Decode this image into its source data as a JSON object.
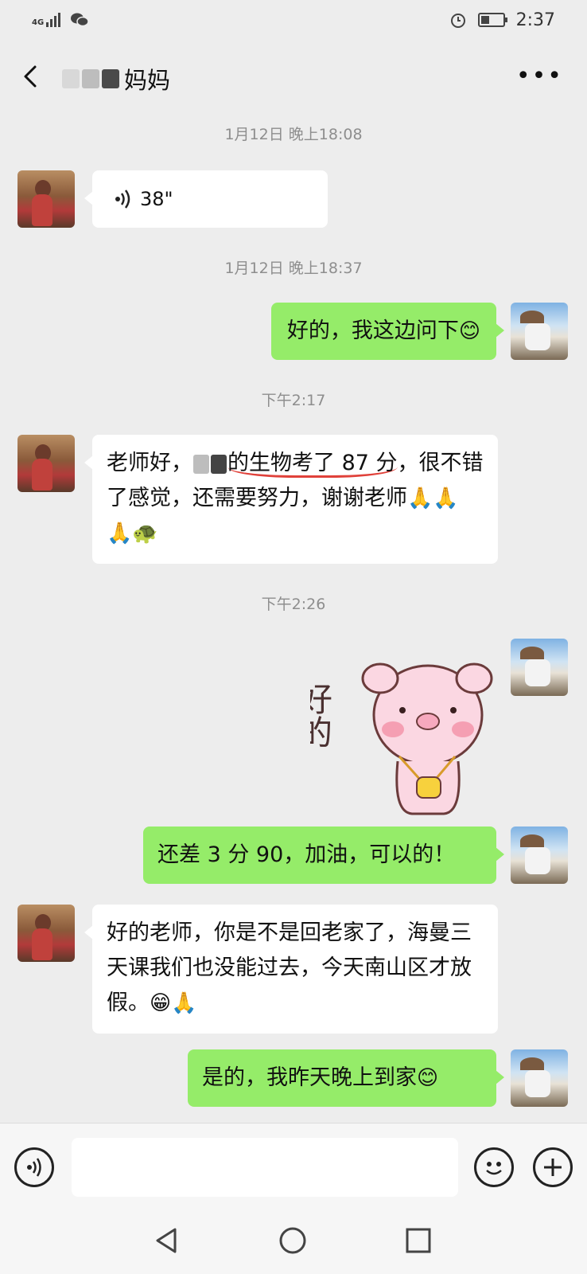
{
  "status_bar": {
    "network": "4G",
    "time": "2:37"
  },
  "header": {
    "title": "妈妈"
  },
  "messages": {
    "ts1": "1月12日 晚上18:08",
    "voice_duration": "38\"",
    "ts2": "1月12日 晚上18:37",
    "msg2": "好的，我这边问下",
    "ts3": "下午2:17",
    "msg3_a": "老师好，",
    "msg3_b": "的生物考了 87 分",
    "msg3_c": "，很不错了感觉，还需要努力，谢谢老师",
    "msg3_emoji": "🙏🙏🙏🐢",
    "ts4": "下午2:26",
    "sticker_text": "好的",
    "msg5": "还差 3 分 90，加油，可以的！",
    "msg6": "好的老师，你是不是回老家了，海曼三天课我们也没能过去，今天南山区才放假。",
    "msg6_emoji": "😁🙏",
    "msg7": "是的，我昨天晚上到家",
    "smile_emoji": "😊"
  },
  "colors": {
    "background": "#ededed",
    "bubble_out": "#95ec69",
    "bubble_in": "#ffffff",
    "underline": "#e0413a"
  },
  "icons": {
    "back": "chevron-left-icon",
    "more": "more-icon",
    "voice": "voice-icon",
    "emoji": "emoji-icon",
    "plus": "plus-icon"
  }
}
